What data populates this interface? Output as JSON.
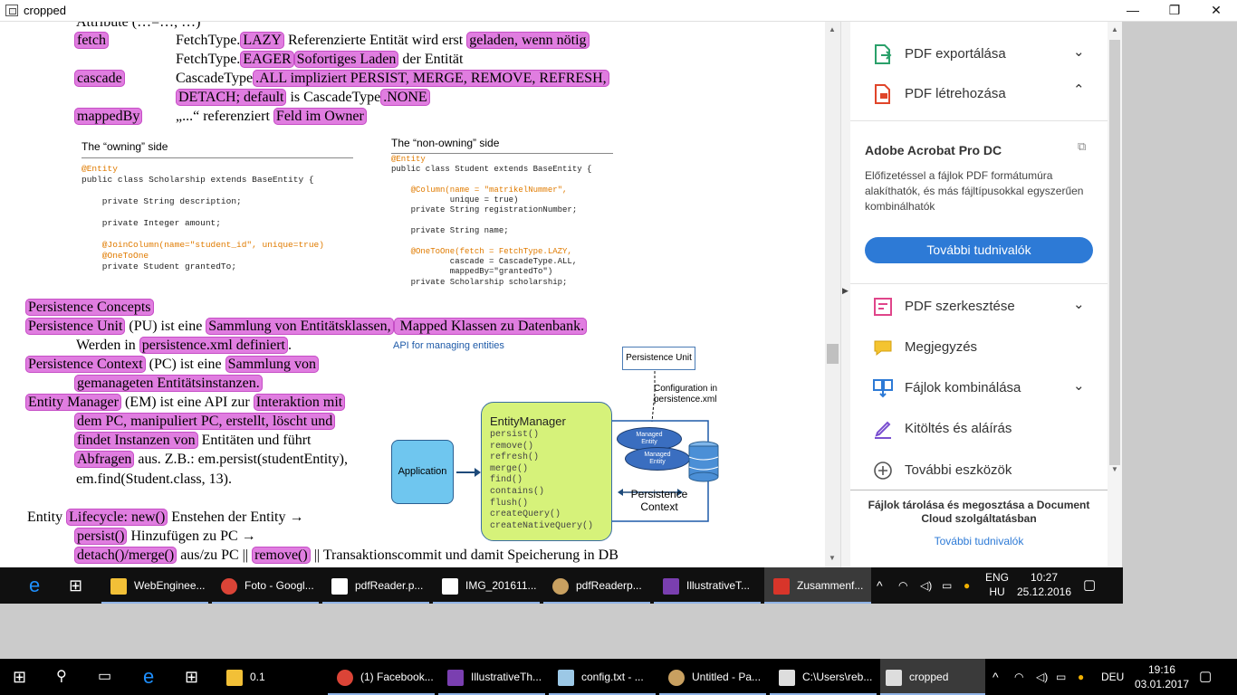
{
  "window": {
    "title": "cropped",
    "min": "—",
    "max": "❐",
    "close": "✕"
  },
  "pdf": {
    "top_partial": "Attribute (…=…, …)",
    "rows": [
      {
        "key": "fetch",
        "v1a": "FetchType.",
        "v1b": "LAZY",
        "v1c": " Referenzierte Entität wird erst ",
        "v1d": "geladen, wenn nötig"
      },
      {
        "v2a": "FetchType.",
        "v2b": "EAGER",
        "v2c": "Sofortiges Laden",
        "v2d": " der Entität"
      },
      {
        "key": "cascade",
        "v1a": "CascadeType",
        "v1b": ".ALL impliziert PERSIST, MERGE, REMOVE, REFRESH,"
      },
      {
        "v2b": "DETACH; default",
        "v2c": " is CascadeType",
        "v2d": ".NONE"
      },
      {
        "key": "mappedBy",
        "v1a": "„...“ referenziert ",
        "v1b": "Feld im Owner"
      }
    ],
    "owning_title": "The “owning” side",
    "owning_code": [
      "@Entity",
      "public class Scholarship extends BaseEntity {",
      "",
      "    private String description;",
      "",
      "    private Integer amount;",
      "",
      "    @JoinColumn(name=\"student_id\", unique=true)",
      "    @OneToOne",
      "    private Student grantedTo;"
    ],
    "nonowning_title": "The “non-owning” side",
    "nonowning_code": [
      "@Entity",
      "public class Student extends BaseEntity {",
      "",
      "    @Column(name = \"matrikelNummer\",",
      "            unique = true)",
      "    private String registrationNumber;",
      "",
      "    private String name;",
      "",
      "    @OneToOne(fetch = FetchType.LAZY,",
      "            cascade = CascadeType.ALL,",
      "            mappedBy=\"grantedTo\")",
      "    private Scholarship scholarship;"
    ],
    "pc_heading": "Persistence Concepts",
    "pu_a": "Persistence Unit",
    "pu_b": " (PU) ist eine ",
    "pu_c": "Sammlung von Entitätsklassen,",
    "pu_d": " Mapped Klassen zu Datenbank.",
    "pu2_a": "Werden in ",
    "pu2_b": "persistence.xml definiert",
    "pu2_c": ".",
    "pctx_a": "Persistence Context",
    "pctx_b": " (PC) ist eine ",
    "pctx_c": "Sammlung von",
    "pctx2": "gemanageten Entitätsinstanzen.",
    "em_a": "Entity Manager",
    "em_b": " (EM) ist eine API zur ",
    "em_c": "Interaktion mit",
    "em2": "dem PC, manipuliert PC, erstellt, löscht und",
    "em3a": "findet Instanzen von",
    "em3b": " Entitäten und führt",
    "em4a": "Abfragen",
    "em4b": " aus. Z.B.: em.persist(studentEntity),",
    "em5": "em.find(Student.class, 13).",
    "lc_a": "Entity ",
    "lc_b": "Lifecycle: new()",
    "lc_c": " Enstehen der Entity →",
    "lc2_a": "persist()",
    "lc2_b": " Hinzufügen zu PC →",
    "lc3_a": "detach()/merge()",
    "lc3_b": " aus/zu PC || ",
    "lc3_c": "remove()",
    "lc3_d": " || Transaktionscommit und damit Speicherung in DB",
    "diagram": {
      "api_label": "API for managing entities",
      "pu_box": "Persistence Unit",
      "config": "Configuration in\npersistence.xml",
      "em_title": "EntityManager",
      "methods": [
        "persist()",
        "remove()",
        "refresh()",
        "merge()",
        "find()",
        "contains()",
        "flush()",
        "createQuery()",
        "createNativeQuery()"
      ],
      "application": "Application",
      "managed1": "Managed\nEntity",
      "managed2": "Managed\nEntity",
      "pc_label": "Persistence\nContext"
    }
  },
  "panel": {
    "export": "PDF exportálása",
    "create": "PDF létrehozása",
    "product": "Adobe Acrobat Pro DC",
    "desc": "Előfizetéssel a fájlok PDF formátumúra alakíthatók, és más fájltípusokkal egyszerűen kombinálhatók",
    "more_btn": "További tudnivalók",
    "edit": "PDF szerkesztése",
    "comment": "Megjegyzés",
    "combine": "Fájlok kombinálása",
    "fill": "Kitöltés és aláírás",
    "more_tools": "További eszközök",
    "footer": "Fájlok tárolása és megosztása a Document Cloud szolgáltatásban",
    "footer_link": "További tudnivalók"
  },
  "taskbar1": {
    "items": [
      "WebEnginee...",
      "Foto - Googl...",
      "pdfReader.p...",
      "IMG_201611...",
      "pdfReaderp...",
      "IllustrativeT...",
      "Zusammenf..."
    ],
    "lang": "ENG",
    "lang2": "HU",
    "time": "10:27",
    "date": "25.12.2016"
  },
  "taskbar2": {
    "items": [
      "0.1",
      "(1) Facebook...",
      "IllustrativeTh...",
      "config.txt - ...",
      "Untitled - Pa...",
      "C:\\Users\\reb...",
      "cropped"
    ],
    "lang": "DEU",
    "time": "19:16",
    "date": "03.01.2017"
  },
  "colors": {
    "highlight": "#e07de0",
    "accent": "#2d7ad6"
  }
}
